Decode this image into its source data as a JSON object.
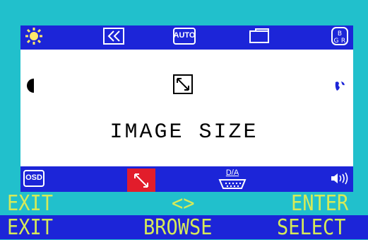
{
  "title": "IMAGE SIZE",
  "hints": {
    "exit": "EXIT",
    "browse": "<>",
    "enter": "ENTER"
  },
  "actions": {
    "exit": "EXIT",
    "browse": "BROWSE",
    "select": "SELECT"
  },
  "icons": {
    "top": [
      "brightness-icon",
      "back-icon",
      "auto-adjust-icon",
      "folder-icon",
      "rgb-color-icon"
    ],
    "left": [
      "contrast-icon",
      "info-icon",
      "osd-settings-icon"
    ],
    "right": [
      "language-globe-icon",
      "input-hourglass-icon",
      "volume-icon"
    ],
    "bottom": [
      "image-size-icon",
      "d-a-input-icon"
    ]
  },
  "labels": {
    "auto": "AUTO",
    "osd": "OSD",
    "da": "D/A",
    "rgb": "RGB"
  },
  "colors": {
    "background": "#21c0cc",
    "osd_blue": "#1c25d8",
    "selected": "#e21d2b",
    "text_yellow": "#d6ea58"
  }
}
